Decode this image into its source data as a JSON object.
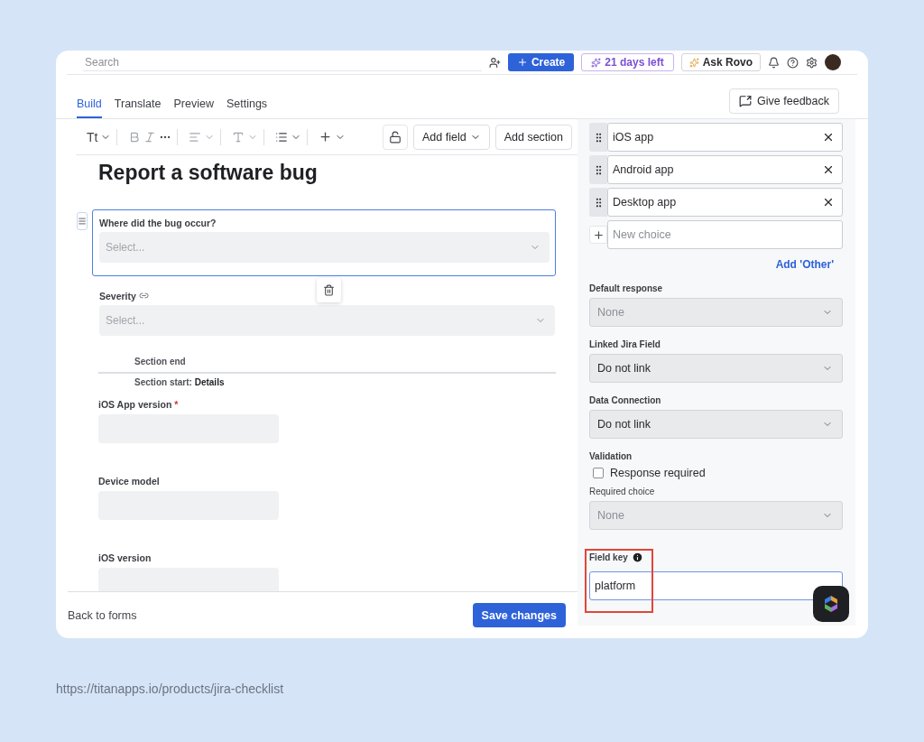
{
  "top_bar": {
    "search_placeholder": "Search",
    "create": "Create",
    "trial": "21 days left",
    "ask": "Ask Rovo"
  },
  "tabs": [
    {
      "label": "Build",
      "selected": true
    },
    {
      "label": "Translate",
      "selected": false
    },
    {
      "label": "Preview",
      "selected": false
    },
    {
      "label": "Settings",
      "selected": false
    }
  ],
  "feedback_button": "Give feedback",
  "toolbar": {
    "text_style": "Tt",
    "add_field": "Add field",
    "add_section": "Add section"
  },
  "form": {
    "title": "Report a software bug",
    "required_mark": "*",
    "fields": [
      {
        "kind": "select",
        "label": "Where did the bug occur?",
        "placeholder": "Select...",
        "selected": true,
        "linked": false
      },
      {
        "kind": "select",
        "label": "Severity",
        "placeholder": "Select...",
        "selected": false,
        "linked": true
      },
      {
        "kind": "section",
        "end": "Section end",
        "start": "Section start: **Details**"
      },
      {
        "kind": "text",
        "label": "iOS App version",
        "required": true
      },
      {
        "kind": "text",
        "label": "Device model",
        "required": false
      },
      {
        "kind": "text",
        "label": "iOS version",
        "required": false
      }
    ]
  },
  "footer": {
    "back": "Back to forms",
    "save": "Save changes"
  },
  "settings": {
    "choices": [
      "iOS app",
      "Android app",
      "Desktop app"
    ],
    "new_choice_placeholder": "New choice",
    "add_other": "Add 'Other'",
    "items": [
      {
        "kind": "select",
        "label": "Default response",
        "value": "None",
        "disabled": true
      },
      {
        "kind": "select",
        "label": "Linked Jira Field",
        "value": "Do not link",
        "disabled": false
      },
      {
        "kind": "select",
        "label": "Data Connection",
        "value": "Do not link",
        "disabled": false
      },
      {
        "kind": "checkbox",
        "label": "Validation",
        "option": "Response required",
        "checked": false
      },
      {
        "kind": "select",
        "label": "Required choice",
        "value": "None",
        "disabled": true,
        "bold": false
      }
    ],
    "field_key": {
      "label": "Field key",
      "value": "platform"
    }
  },
  "url": "https://titanapps.io/products/jira-checklist"
}
